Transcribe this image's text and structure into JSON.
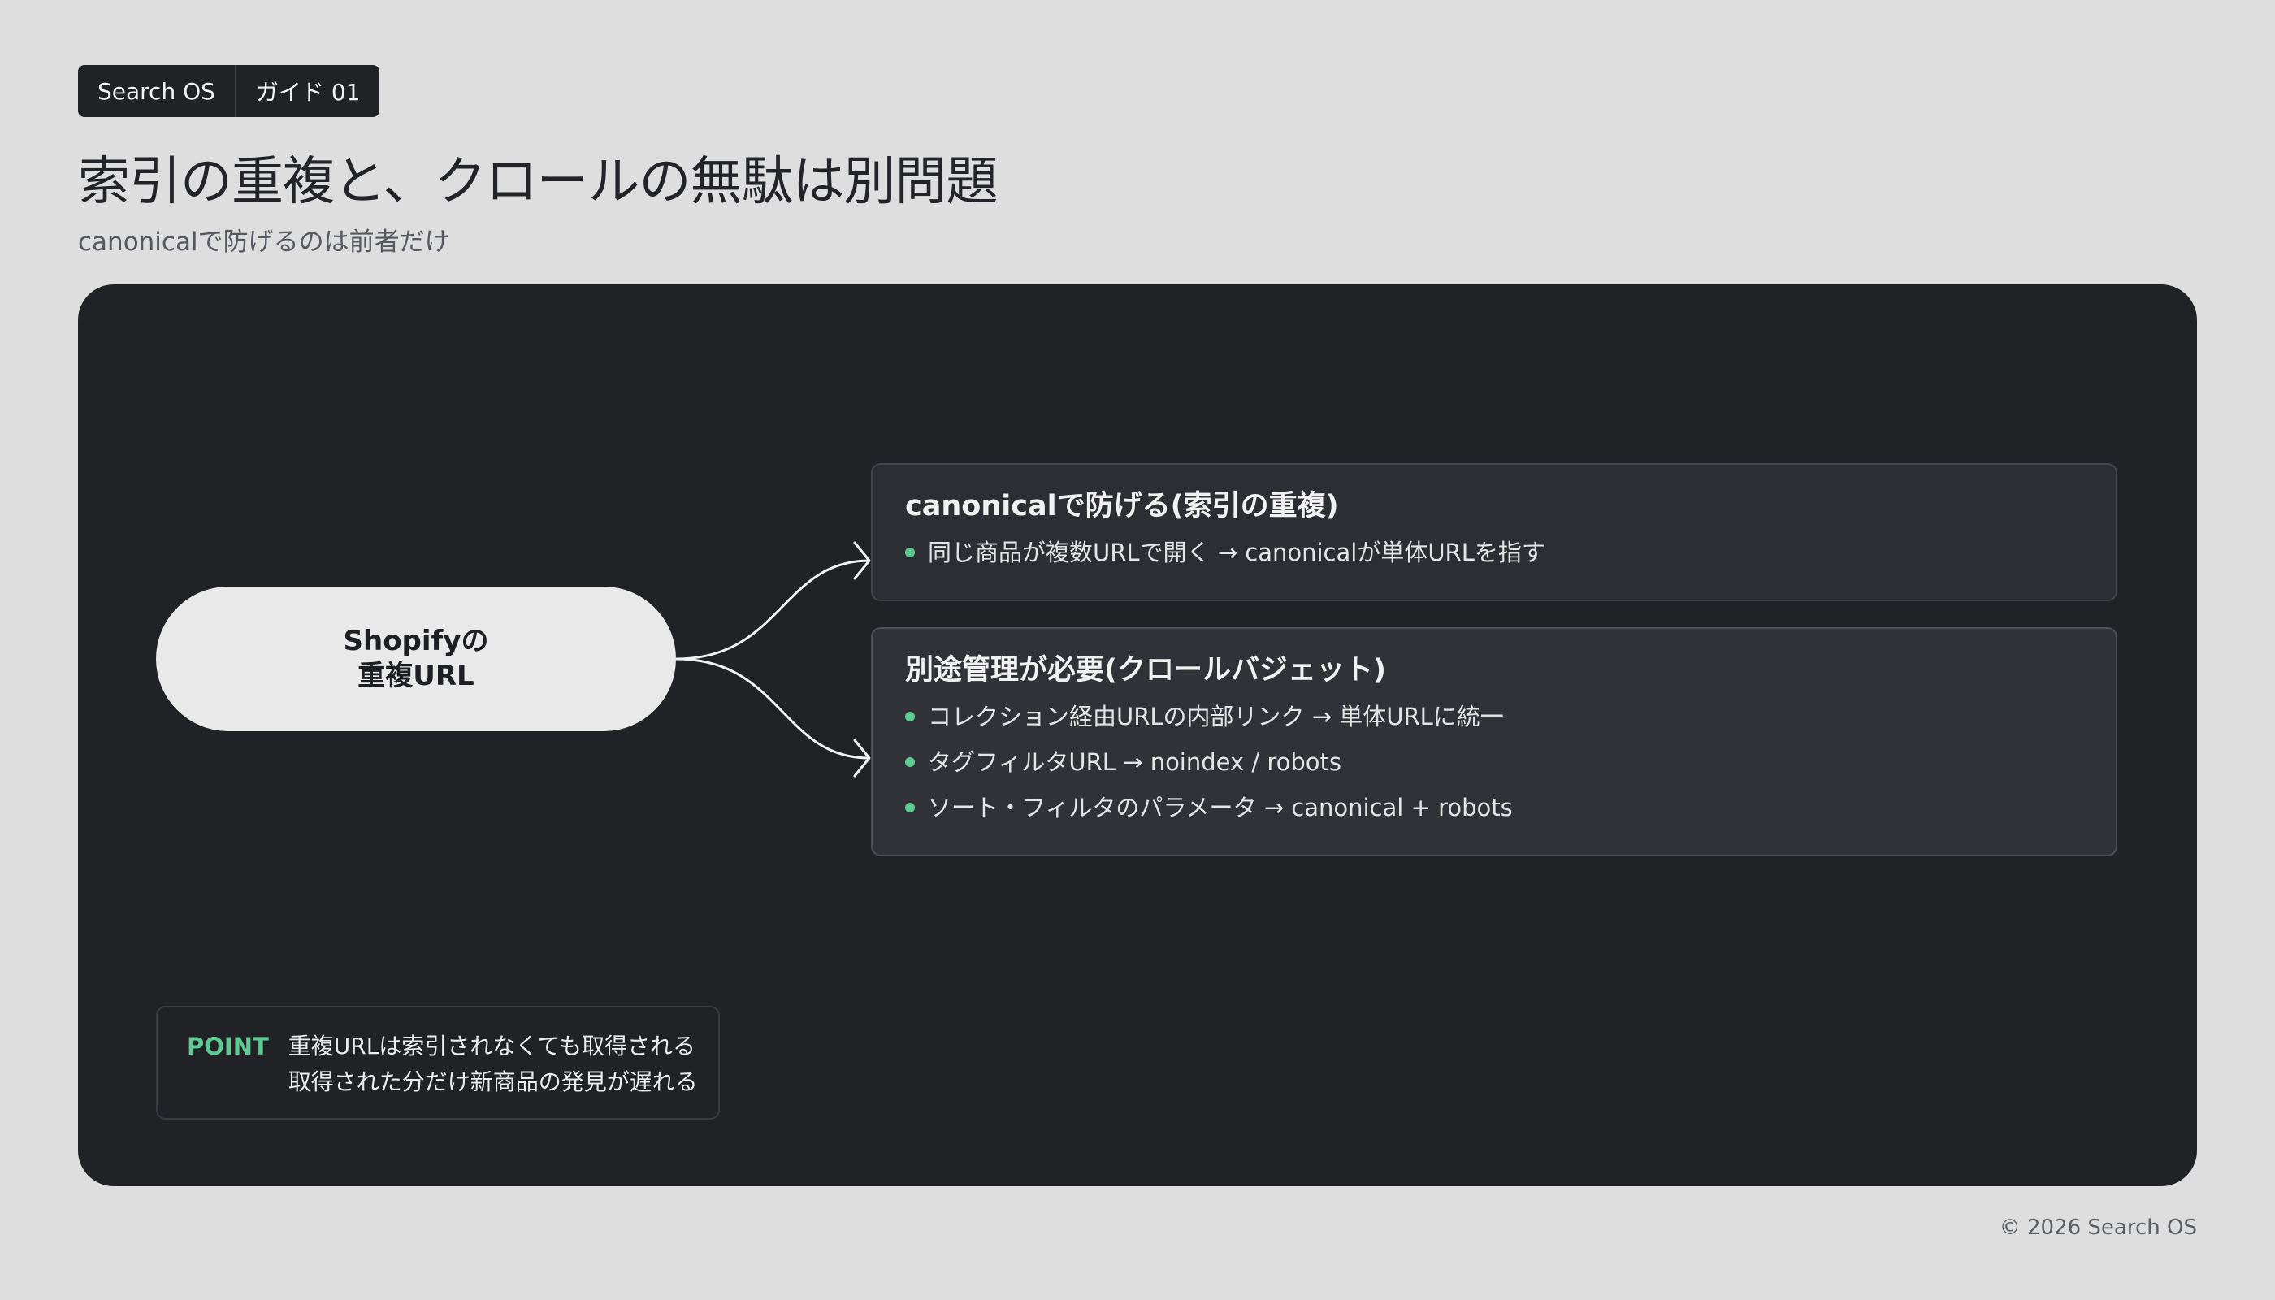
{
  "header": {
    "brand_tag": "Search OS",
    "guide_tag": "ガイド 01",
    "title": "索引の重複と、クロールの無駄は別問題",
    "subtitle": "canonicalで防げるのは前者だけ"
  },
  "diagram": {
    "source": {
      "line1": "Shopifyの",
      "line2": "重複URL"
    },
    "branches": [
      {
        "title": "canonicalで防げる(索引の重複)",
        "items": [
          "同じ商品が複数URLで開く → canonicalが単体URLを指す"
        ]
      },
      {
        "title": "別途管理が必要(クロールバジェット)",
        "items": [
          "コレクション経由URLの内部リンク → 単体URLに統一",
          "タグフィルタURL → noindex / robots",
          "ソート・フィルタのパラメータ → canonical + robots"
        ]
      }
    ]
  },
  "point": {
    "label": "POINT",
    "line1": "重複URLは索引されなくても取得される",
    "line2": "取得された分だけ新商品の発見が遅れる"
  },
  "footer": {
    "copyright": "© 2026 Search OS"
  },
  "colors": {
    "accent": "#5fcb93",
    "panel": "#202226",
    "background": "#dedede",
    "node": "#e9e9e9"
  }
}
